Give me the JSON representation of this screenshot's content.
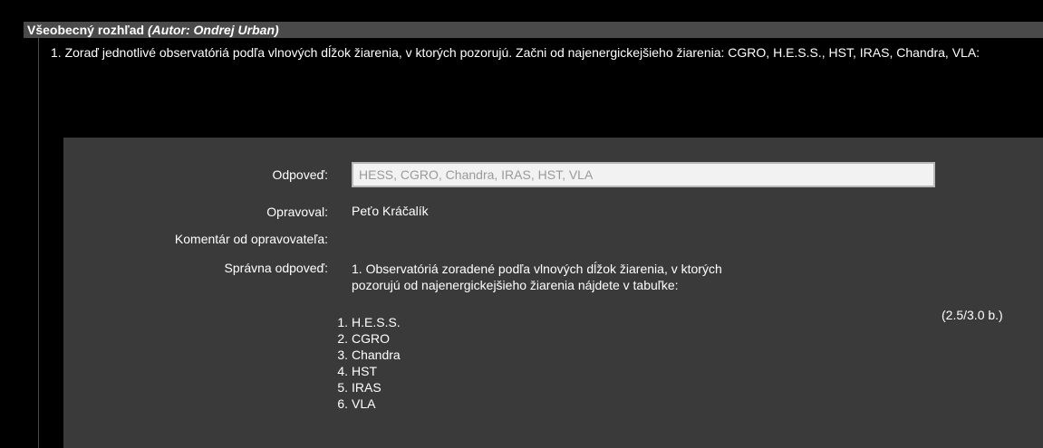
{
  "header": {
    "section_title": "Všeobecný rozhľad",
    "author": "(Autor: Ondrej Urban)"
  },
  "question": {
    "text": "1. Zoraď jednotlivé observatóriá podľa vlnových dĺžok žiarenia, v ktorých pozorujú. Začni od najenergickejšieho žiarenia: CGRO, H.E.S.S., HST, IRAS, Chandra, VLA:"
  },
  "answer": {
    "label": "Odpoveď:",
    "value": "HESS, CGRO, Chandra, IRAS, HST, VLA"
  },
  "grader": {
    "label": "Opravoval:",
    "value": "Peťo Kráčalík"
  },
  "comment": {
    "label": "Komentár od opravovateľa:",
    "value": ""
  },
  "correct_answer": {
    "label": "Správna odpoveď:",
    "intro": "1. Observatóriá zoradené podľa vlnových dĺžok žiarenia, v ktorých pozorujú od najenergickejšieho žiarenia nájdete v tabuľke:",
    "items": [
      {
        "num": "1.",
        "text": "H.E.S.S."
      },
      {
        "num": "2.",
        "text": "CGRO"
      },
      {
        "num": "3.",
        "text": "Chandra"
      },
      {
        "num": "4.",
        "text": "HST"
      },
      {
        "num": "5.",
        "text": "IRAS"
      },
      {
        "num": "6.",
        "text": "VLA"
      }
    ]
  },
  "score": "(2.5/3.0 b.)",
  "colors": {
    "background": "#000000",
    "header_bar": "#4a4a4a",
    "answer_panel": "#3a3a3a",
    "text": "#ffffff",
    "input_text": "#9a9a9a"
  }
}
